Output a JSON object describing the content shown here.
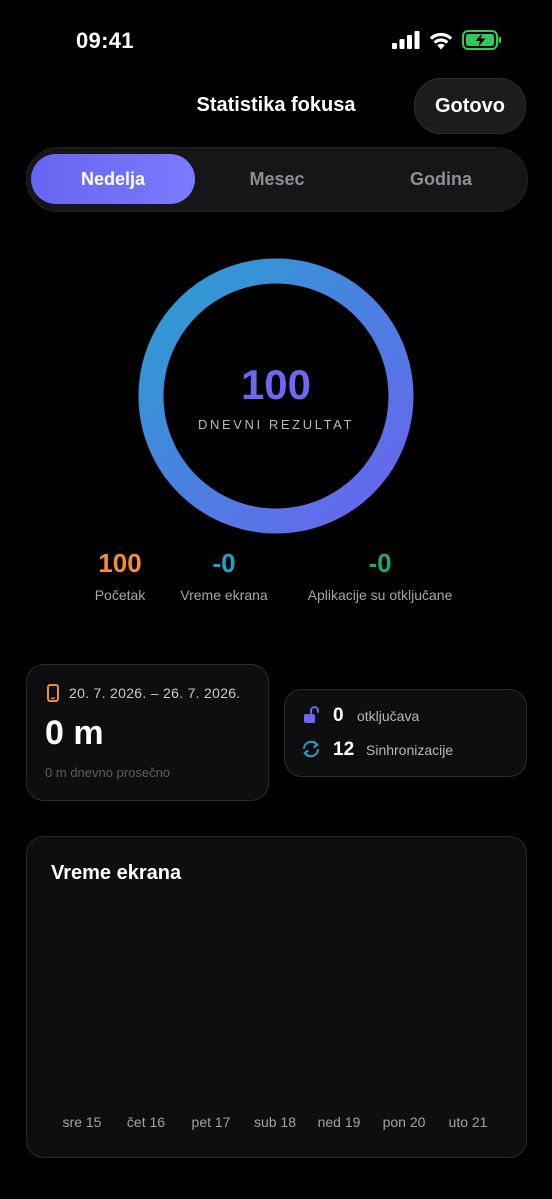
{
  "status_bar": {
    "time": "09:41"
  },
  "header": {
    "title": "Statistika fokusa",
    "done_label": "Gotovo"
  },
  "tabs": [
    {
      "label": "Nedelja",
      "active": true
    },
    {
      "label": "Mesec",
      "active": false
    },
    {
      "label": "Godina",
      "active": false
    }
  ],
  "score": {
    "value": "100",
    "label": "DNEVNI REZULTAT",
    "fraction": 1.0
  },
  "stats": [
    {
      "value": "100",
      "label": "Početak",
      "color": "#f28c38"
    },
    {
      "value": "-0",
      "label": "Vreme ekrana",
      "color": "#1fa2c7"
    },
    {
      "value": "-0",
      "label": "Aplikacije su otključane",
      "color": "#20a86b"
    }
  ],
  "screen_time_card": {
    "date_range": "20. 7. 2026. – 26. 7. 2026.",
    "total": "0 m",
    "average": "0 m dnevno prosečno"
  },
  "summary_card": {
    "unlocks_value": "0",
    "unlocks_label": "otključava",
    "syncs_value": "12",
    "syncs_label": "Sinhronizacije"
  },
  "chart_data": {
    "type": "bar",
    "title": "Vreme ekrana",
    "categories": [
      "sre 15",
      "čet 16",
      "pet 17",
      "sub 18",
      "ned 19",
      "pon 20",
      "uto 21"
    ],
    "values": [
      0,
      0,
      0,
      0,
      0,
      0,
      0
    ]
  },
  "colors": {
    "accent": "#6d67f2",
    "ring_start": "#6b63f0",
    "ring_end": "#2a9fd0",
    "battery": "#34c759"
  }
}
